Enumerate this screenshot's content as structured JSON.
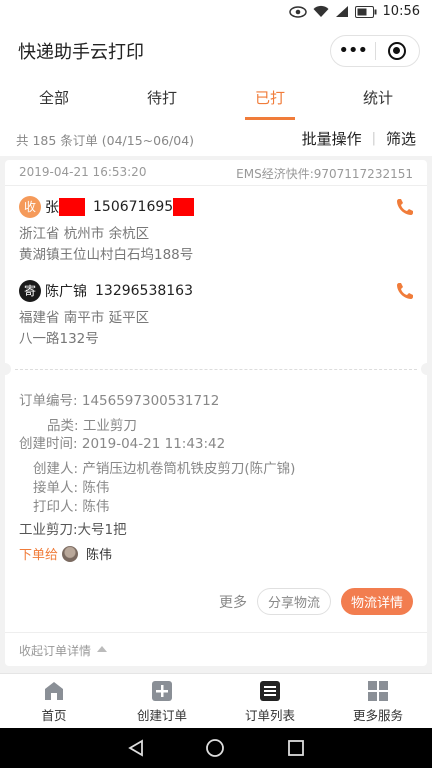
{
  "status_bar": {
    "time": "10:56"
  },
  "app": {
    "title": "快递助手云打印"
  },
  "capsule": {
    "more_glyph": "•••"
  },
  "tabs": [
    {
      "label": "全部",
      "active": false
    },
    {
      "label": "待打",
      "active": false
    },
    {
      "label": "已打",
      "active": true
    },
    {
      "label": "统计",
      "active": false
    }
  ],
  "summary": {
    "count_text": "共 185 条订单 (04/15~06/04)",
    "batch_label": "批量操作",
    "filter_label": "筛选"
  },
  "order": {
    "date": "2019-04-21 16:53:20",
    "tracking": "EMS经济快件:9707117232151",
    "receiver": {
      "badge": "收",
      "name_visible": "张",
      "phone_visible": "150671695",
      "address_line1": "浙江省 杭州市 余杭区",
      "address_line2": "黄湖镇王位山村白石坞188号"
    },
    "sender": {
      "badge": "寄",
      "name": "陈广锦",
      "phone": "13296538163",
      "address_line1": "福建省 南平市 延平区",
      "address_line2": "八一路132号"
    },
    "details": {
      "order_no_label": "订单编号:",
      "order_no": "1456597300531712",
      "category_label": "品类:",
      "category": "工业剪刀",
      "created_label": "创建时间:",
      "created": "2019-04-21 11:43:42",
      "creator_label": "创建人:",
      "creator": "产销压边机卷筒机铁皮剪刀(陈广锦)",
      "receiver_person_label": "接单人:",
      "receiver_person": "陈伟",
      "printer_label": "打印人:",
      "printer": "陈伟",
      "goods": "工业剪刀:大号1把"
    },
    "order_to_label": "下单给",
    "order_to_name": "陈伟",
    "buttons": {
      "more": "更多",
      "share": "分享物流",
      "detail": "物流详情"
    },
    "collapse_label": "收起订单详情"
  },
  "bottom_nav": [
    {
      "label": "首页",
      "icon": "home-icon"
    },
    {
      "label": "创建订单",
      "icon": "plus-square-icon"
    },
    {
      "label": "订单列表",
      "icon": "list-icon"
    },
    {
      "label": "更多服务",
      "icon": "grid-icon"
    }
  ],
  "colors": {
    "accent": "#f07c3a",
    "button": "#f27d4f",
    "redaction": "#ff0000"
  }
}
